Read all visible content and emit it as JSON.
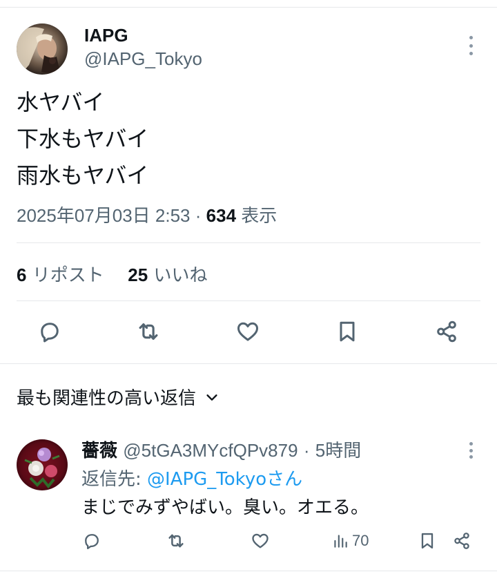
{
  "tweet": {
    "display_name": "IAPG",
    "handle": "@IAPG_Tokyo",
    "lines": [
      "水ヤバイ",
      "下水もヤバイ",
      "雨水もヤバイ"
    ],
    "timestamp": "2025年07月03日 2:53",
    "separator": "·",
    "views_count": "634",
    "views_label": "表示",
    "reposts_count": "6",
    "reposts_label": "リポスト",
    "likes_count": "25",
    "likes_label": "いいね",
    "actions": [
      "reply-icon",
      "repost-icon",
      "like-icon",
      "bookmark-icon",
      "share-icon"
    ]
  },
  "replies_filter": {
    "label": "最も関連性の高い返信"
  },
  "reply": {
    "display_name": "薔薇",
    "handle": "@5tGA3MYcfQPv879",
    "separator": "·",
    "time": "5時間",
    "reply_to_prefix": "返信先: ",
    "reply_to_handle": "@IAPG_Tokyoさん",
    "text": "まじでみずやばい。臭い。オエる。",
    "views": "70"
  },
  "colors": {
    "text": "#0f1419",
    "secondary": "#536471",
    "link": "#1d9bf0",
    "divider": "#e6e8ea"
  }
}
